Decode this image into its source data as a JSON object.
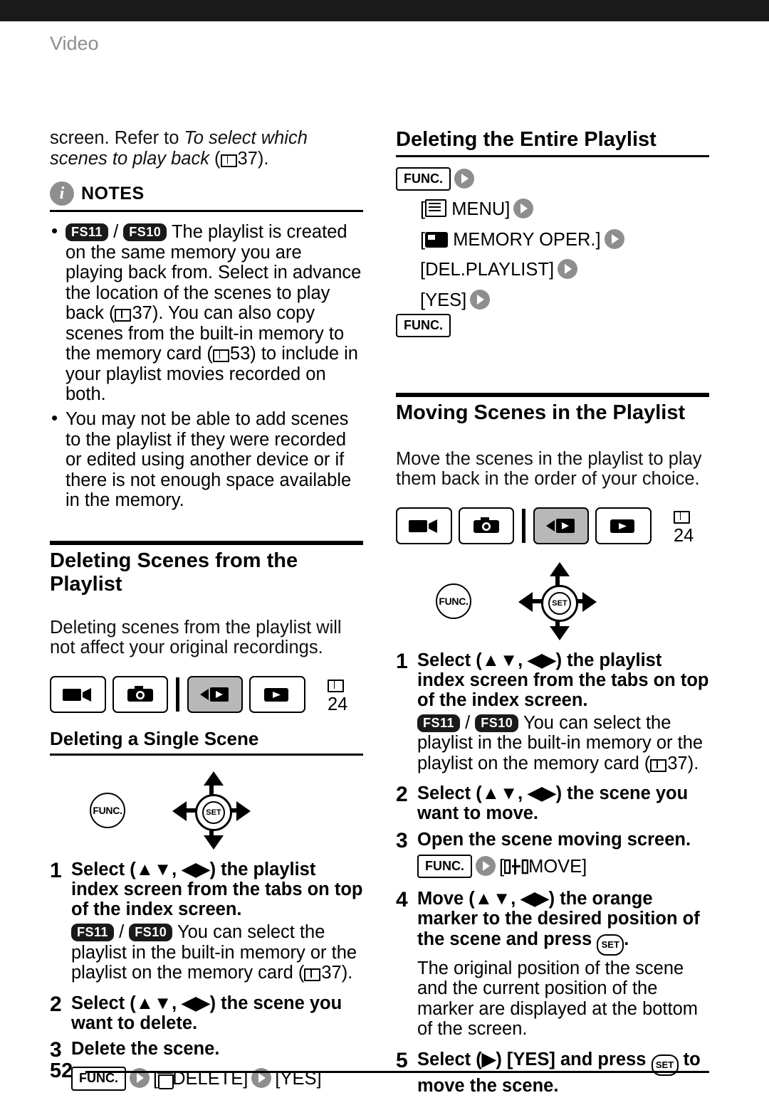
{
  "header": {
    "section_label": "Video"
  },
  "page_number": "52",
  "left_column": {
    "intro_text_1": "screen. Refer to ",
    "intro_text_italic": "To select which scenes to play back",
    "intro_text_ref": "37",
    "intro_text_end": ").",
    "notes_title": "NOTES",
    "notes": [
      {
        "badges": [
          "FS11",
          "FS10"
        ],
        "text": "The playlist is created on the same memory you are playing back from. Select in advance the location of the scenes to play back (",
        "ref1": "37",
        "text2": "). You can also copy scenes from the built-in memory to the memory card (",
        "ref2": "53",
        "text3": ") to include in your playlist movies recorded on both."
      },
      {
        "badges": [],
        "text": "You may not be able to add scenes to the playlist if they were recorded or edited using another device or if there is not enough space available in the memory.",
        "ref1": "",
        "text2": "",
        "ref2": "",
        "text3": ""
      }
    ],
    "section_title": "Deleting Scenes from the Playlist",
    "section_intro": "Deleting scenes from the playlist will not affect your original recordings.",
    "mode_ref": "24",
    "mode_icons": [
      "camera-video-icon",
      "camera-photo-icon",
      "playback-video-icon",
      "playback-photo-icon"
    ],
    "subsection_title": "Deleting a Single Scene",
    "func_label": "FUNC.",
    "set_label": "SET",
    "steps": [
      {
        "num": "1",
        "text": "Select (▲▼, ◀▶) the playlist index screen from the tabs on top of the index screen.",
        "note_badges": [
          "FS11",
          "FS10"
        ],
        "note": "You can select the playlist in the built-in memory or the playlist on the memory card (",
        "note_ref": "37",
        "note_end": ")."
      },
      {
        "num": "2",
        "text": "Select (▲▼, ◀▶) the scene you want to delete.",
        "note_badges": [],
        "note": "",
        "note_ref": "",
        "note_end": ""
      },
      {
        "num": "3",
        "text": "Delete the scene.",
        "note_badges": [],
        "note": "",
        "note_ref": "",
        "note_end": ""
      }
    ],
    "command_line": {
      "func": "FUNC.",
      "item1": "[",
      "item1_label": "DELETE]",
      "item2": "[YES]"
    }
  },
  "right_column": {
    "section_title_1": "Deleting the Entire Playlist",
    "commands": {
      "func_start": "FUNC.",
      "line1": "[",
      "line1_label": "MENU]",
      "line2": "[",
      "line2_label": "MEMORY OPER.]",
      "line3": "[DEL.PLAYLIST]",
      "line4": "[YES]",
      "func_end": "FUNC."
    },
    "section_title_2": "Moving Scenes in the Playlist",
    "section_intro": "Move the scenes in the playlist to play them back in the order of your choice.",
    "mode_ref": "24",
    "mode_icons": [
      "camera-video-icon",
      "camera-photo-icon",
      "playback-video-icon",
      "playback-photo-icon"
    ],
    "func_label": "FUNC.",
    "set_label": "SET",
    "steps": [
      {
        "num": "1",
        "text": "Select (▲▼, ◀▶) the playlist index screen from the tabs on top of the index screen.",
        "note_badges": [
          "FS11",
          "FS10"
        ],
        "note": "You can select the playlist in the built-in memory or the playlist on the memory card (",
        "note_ref": "37",
        "note_end": ")."
      },
      {
        "num": "2",
        "text": "Select (▲▼, ◀▶) the scene you want to move.",
        "note_badges": [],
        "note": "",
        "note_ref": "",
        "note_end": ""
      },
      {
        "num": "3",
        "text": "Open the scene moving screen.",
        "note_badges": [],
        "note": "",
        "note_ref": "",
        "note_end": ""
      },
      {
        "num": "4",
        "text": "Move (▲▼, ◀▶) the orange marker to the desired position of the scene and press",
        "note_badges": [],
        "note": "The original position of the scene and the current position of the marker are displayed at the bottom of the screen.",
        "note_ref": "",
        "note_end": ""
      },
      {
        "num": "5",
        "text": "Select (▶) [YES] and press",
        "note_badges": [],
        "note": "",
        "note_ref": "",
        "note_end": "",
        "text_tail": "to move the scene."
      }
    ],
    "move_command": {
      "func": "FUNC.",
      "label": "MOVE]"
    }
  }
}
